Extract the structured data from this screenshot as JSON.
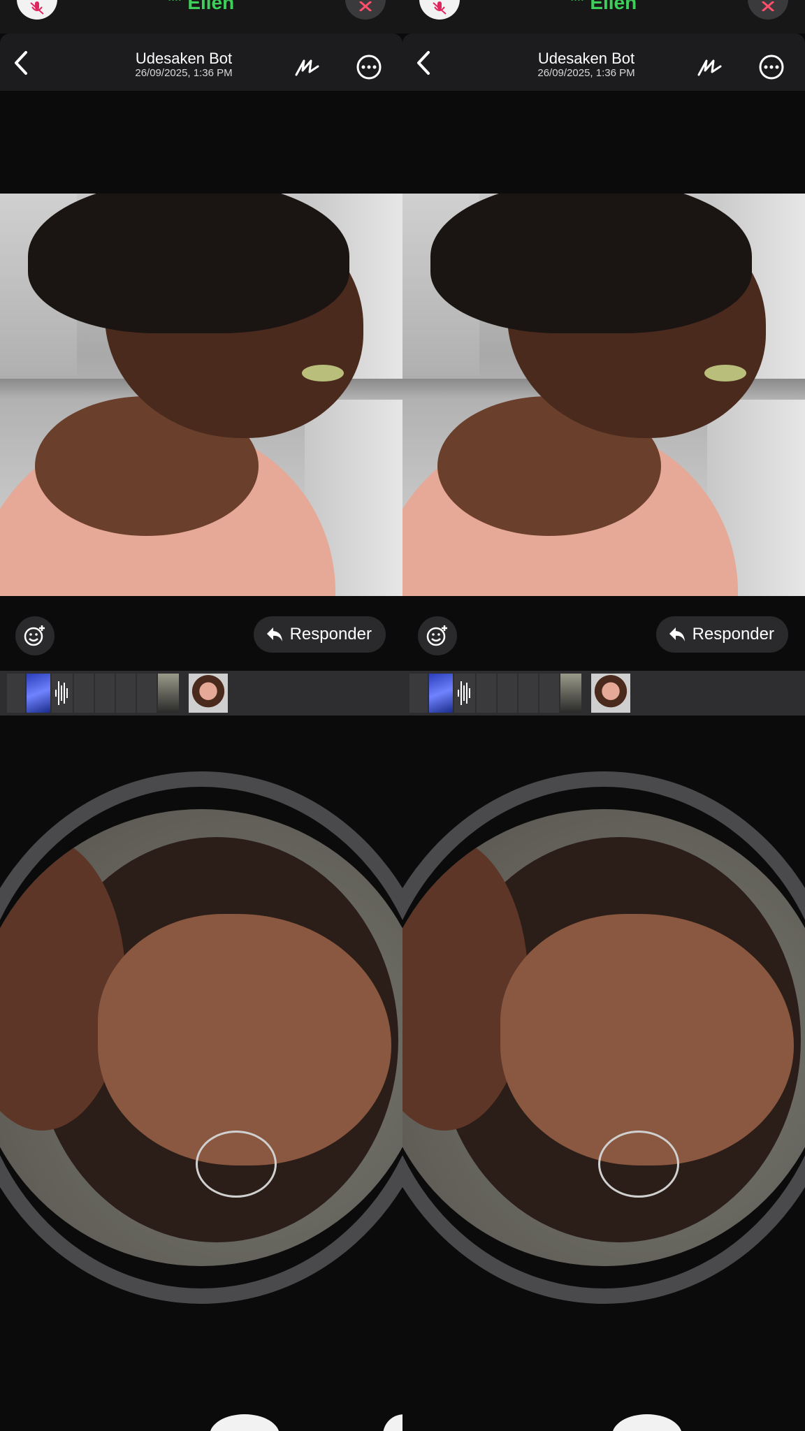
{
  "call": {
    "name": "Ellen",
    "dots": "....",
    "mic_icon": "mic-off-icon",
    "end_icon": "close-icon"
  },
  "header": {
    "title": "Udesaken Bot",
    "subtitle": "26/09/2025, 1:36 PM",
    "back_icon": "chevron-left-icon",
    "markup_icon": "markup-pen-icon",
    "more_icon": "ellipsis-circle-icon"
  },
  "actions": {
    "reply_label": "Responder",
    "emoji_icon": "add-reaction-icon"
  },
  "colors": {
    "accent_green": "#3ecf5a",
    "background": "#0b0b0c",
    "header_bg": "#1c1c1e",
    "end_call_red": "#ff4f6a"
  }
}
